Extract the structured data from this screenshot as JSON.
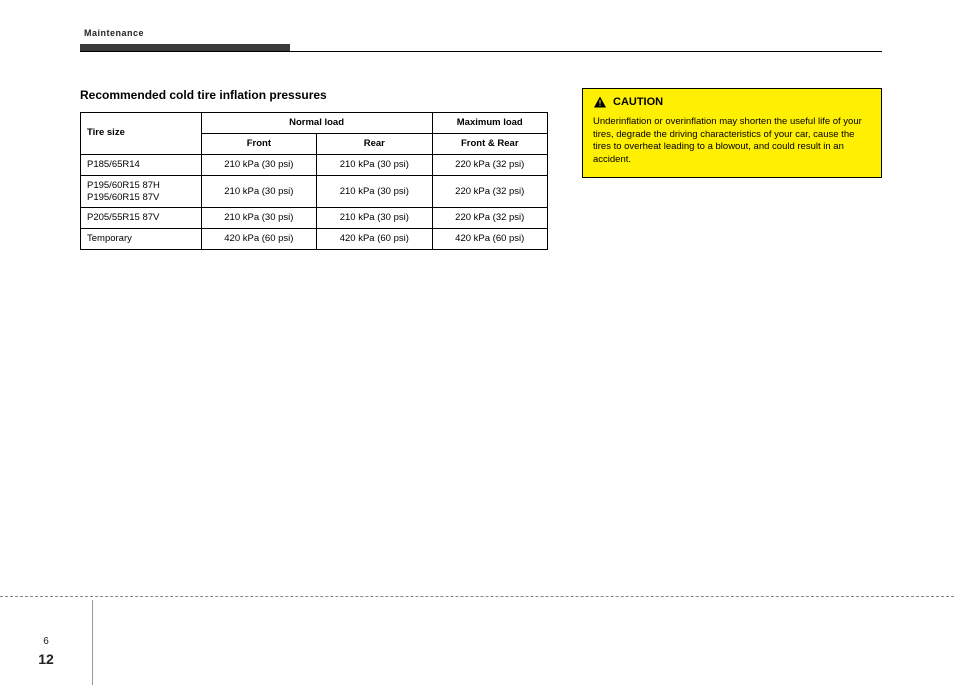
{
  "header": {
    "tab_label": "Maintenance"
  },
  "section": {
    "title": "Recommended cold tire inflation pressures"
  },
  "table": {
    "h_tire_size": "Tire size",
    "h_normal": "Normal load",
    "h_max": "Maximum load",
    "h_front": "Front",
    "h_rear": "Rear",
    "h_front_rear": "Front & Rear",
    "rows": [
      {
        "size": "P185/65R14",
        "f": "210 kPa (30 psi)",
        "r": "210 kPa (30 psi)",
        "max": "220 kPa (32 psi)"
      },
      {
        "size": "P195/60R15 87H\nP195/60R15 87V",
        "f": "210 kPa (30 psi)",
        "r": "210 kPa (30 psi)",
        "max": "220 kPa (32 psi)"
      },
      {
        "size": "P205/55R15 87V",
        "f": "210 kPa (30 psi)",
        "r": "210 kPa (30 psi)",
        "max": "220 kPa (32 psi)"
      },
      {
        "size": "Temporary",
        "f": "420 kPa (60 psi)",
        "r": "420 kPa (60 psi)",
        "max": "420 kPa (60 psi)"
      }
    ]
  },
  "caution": {
    "title": "CAUTION",
    "body": "Underinflation or overinflation may shorten the useful life of your tires, degrade the driving characteristics of your car, cause the tires to overheat leading to a blowout, and could result in an accident."
  },
  "footer": {
    "section_number": "6",
    "page_number": "12"
  }
}
